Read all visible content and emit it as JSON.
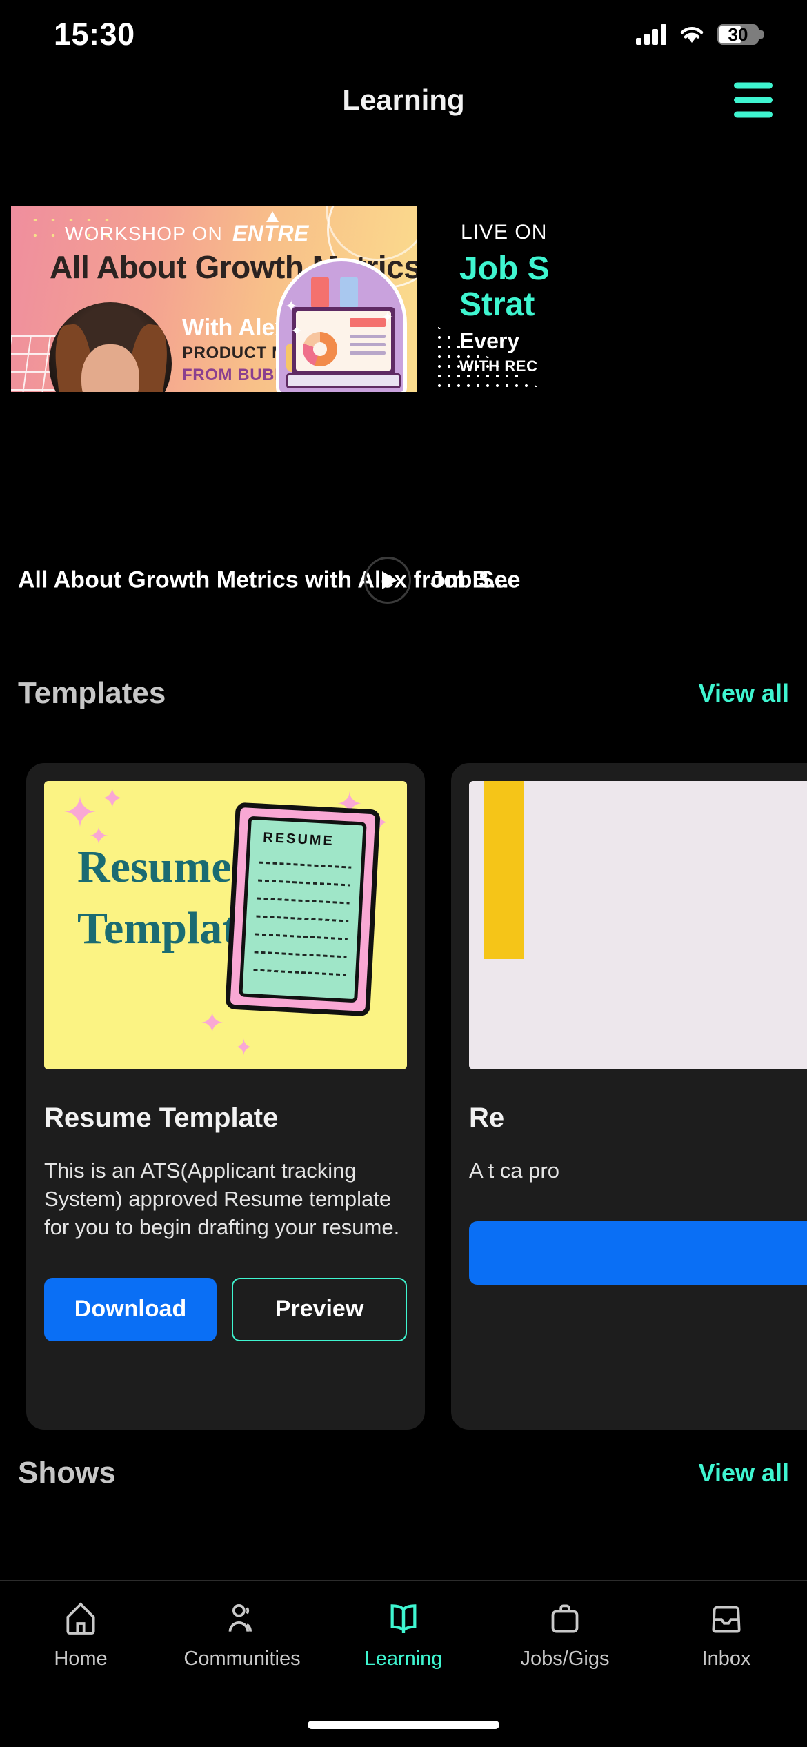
{
  "status_bar": {
    "time": "15:30",
    "battery_percent": "30",
    "icons": [
      "cellular-signal-icon",
      "wifi-icon",
      "battery-icon"
    ]
  },
  "header": {
    "title": "Learning",
    "menu_icon": "hamburger-menu-icon",
    "accent_color": "#3FF5D0"
  },
  "carousel": {
    "slides": [
      {
        "kicker": "WORKSHOP ON",
        "brand": "ENTRE",
        "title": "All About Growth Metrics",
        "speaker": "With Alex Bolanos",
        "role": "PRODUCT MANAGER",
        "org": "FROM BUBBLE",
        "video_title": "All About Growth Metrics with Alex from B...",
        "play_icon": "play-icon"
      },
      {
        "kicker": "LIVE ON",
        "title_line1": "Job S",
        "title_line2": "Strat",
        "sub": "Every",
        "sub2": "WITH REC",
        "video_title": "Job See"
      }
    ]
  },
  "templates_section": {
    "title": "Templates",
    "view_all": "View all",
    "cards": [
      {
        "image_title_line1": "Resume",
        "image_title_line2": "Template",
        "image_bg": "#FBF383",
        "image_text_color": "#1A6B72",
        "doc_label": "RESUME",
        "name": "Resume Template",
        "description": "This is an ATS(Applicant tracking System) approved Resume template for you to begin drafting your resume.",
        "download_label": "Download",
        "preview_label": "Preview",
        "download_color": "#0A6FF5"
      },
      {
        "name": "Re",
        "description": "A t ca pro",
        "download_label": "",
        "preview_label": ""
      }
    ]
  },
  "shows_section": {
    "title": "Shows",
    "view_all": "View all"
  },
  "tab_bar": {
    "items": [
      {
        "label": "Home",
        "icon": "home-icon",
        "active": false
      },
      {
        "label": "Communities",
        "icon": "people-icon",
        "active": false
      },
      {
        "label": "Learning",
        "icon": "book-icon",
        "active": true
      },
      {
        "label": "Jobs/Gigs",
        "icon": "briefcase-icon",
        "active": false
      },
      {
        "label": "Inbox",
        "icon": "inbox-icon",
        "active": false
      }
    ],
    "active_color": "#3FF5D0",
    "inactive_color": "#C9C9C9"
  }
}
